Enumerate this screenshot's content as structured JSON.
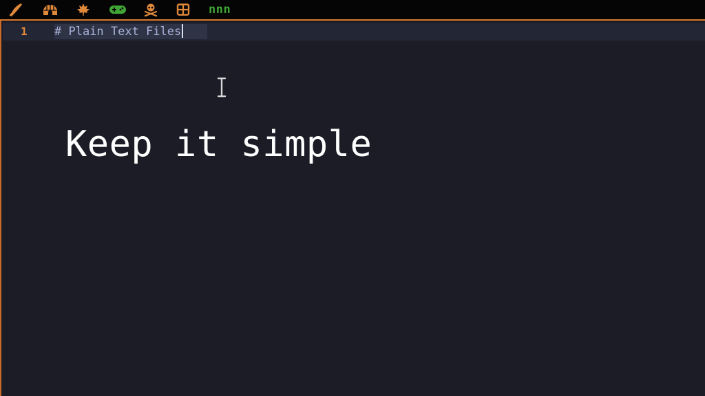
{
  "topbar": {
    "workspaces": [
      {
        "icon": "quill-icon",
        "color": "#e0893a"
      },
      {
        "icon": "igloo-icon",
        "color": "#e0893a"
      },
      {
        "icon": "maple-leaf-icon",
        "color": "#e0893a"
      },
      {
        "icon": "gamepad-icon",
        "color": "#3fa535"
      },
      {
        "icon": "skull-crossbones-icon",
        "color": "#e0893a"
      },
      {
        "icon": "grid-window-icon",
        "color": "#e0893a"
      }
    ],
    "active_label": "nnn",
    "accent_color": "#d9782d"
  },
  "editor": {
    "line_number": "1",
    "line_text": "# Plain Text Files",
    "cursor_line": 1
  },
  "overlay_caption": "Keep it simple"
}
